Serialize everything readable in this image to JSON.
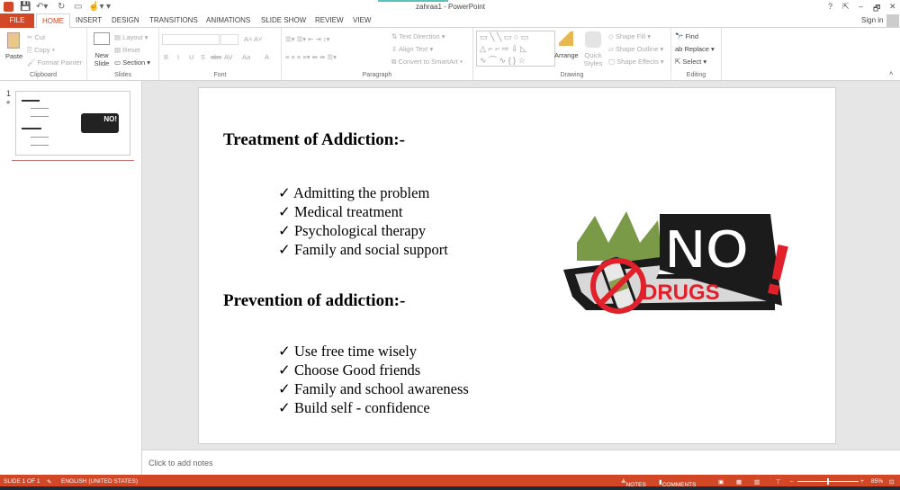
{
  "window": {
    "title": "zahraa1 - PowerPoint",
    "help": "?",
    "restore_ribbon": "⇱",
    "minimize": "–",
    "maximize": "🗗",
    "close": "✕",
    "sign_in": "Sign in"
  },
  "tabs": [
    "FILE",
    "HOME",
    "INSERT",
    "DESIGN",
    "TRANSITIONS",
    "ANIMATIONS",
    "SLIDE SHOW",
    "REVIEW",
    "VIEW"
  ],
  "ribbon": {
    "clipboard": {
      "label": "Clipboard",
      "paste": "Paste",
      "cut": "Cut",
      "copy": "Copy",
      "format_painter": "Format Painter"
    },
    "slides": {
      "label": "Slides",
      "new_slide": "New Slide",
      "layout": "Layout",
      "reset": "Reset",
      "section": "Section"
    },
    "font": {
      "label": "Font",
      "bold": "B",
      "italic": "I",
      "underline": "U",
      "shadow": "S",
      "strike": "abc",
      "spacing": "AV",
      "case": "Aa",
      "color": "A"
    },
    "paragraph": {
      "label": "Paragraph",
      "text_direction": "Text Direction",
      "align_text": "Align Text",
      "smartart": "Convert to SmartArt"
    },
    "drawing": {
      "label": "Drawing",
      "arrange": "Arrange",
      "quick_styles": "Quick Styles",
      "shape_fill": "Shape Fill",
      "shape_outline": "Shape Outline",
      "shape_effects": "Shape Effects"
    },
    "editing": {
      "label": "Editing",
      "find": "Find",
      "replace": "Replace",
      "select": "Select"
    }
  },
  "sidebar": {
    "slide_number": "1"
  },
  "slide": {
    "heading1": "Treatment of Addiction:-",
    "list1": [
      "Admitting the problem",
      "Medical treatment",
      "Psychological therapy",
      "Family and social support"
    ],
    "heading2": "Prevention of addiction:-",
    "list2": [
      "Use free time wisely",
      "Choose Good friends",
      "Family and school awareness",
      "Build self - confidence"
    ],
    "logo_text": "NO DRUGS!"
  },
  "notes": {
    "placeholder": "Click to add notes"
  },
  "status": {
    "slide": "SLIDE 1 OF 1",
    "language": "ENGLISH (UNITED STATES)",
    "notes": "NOTES",
    "comments": "COMMENTS",
    "zoom": "85%",
    "zoom_fraction": 0.5
  },
  "colors": {
    "accent": "#d24726"
  }
}
